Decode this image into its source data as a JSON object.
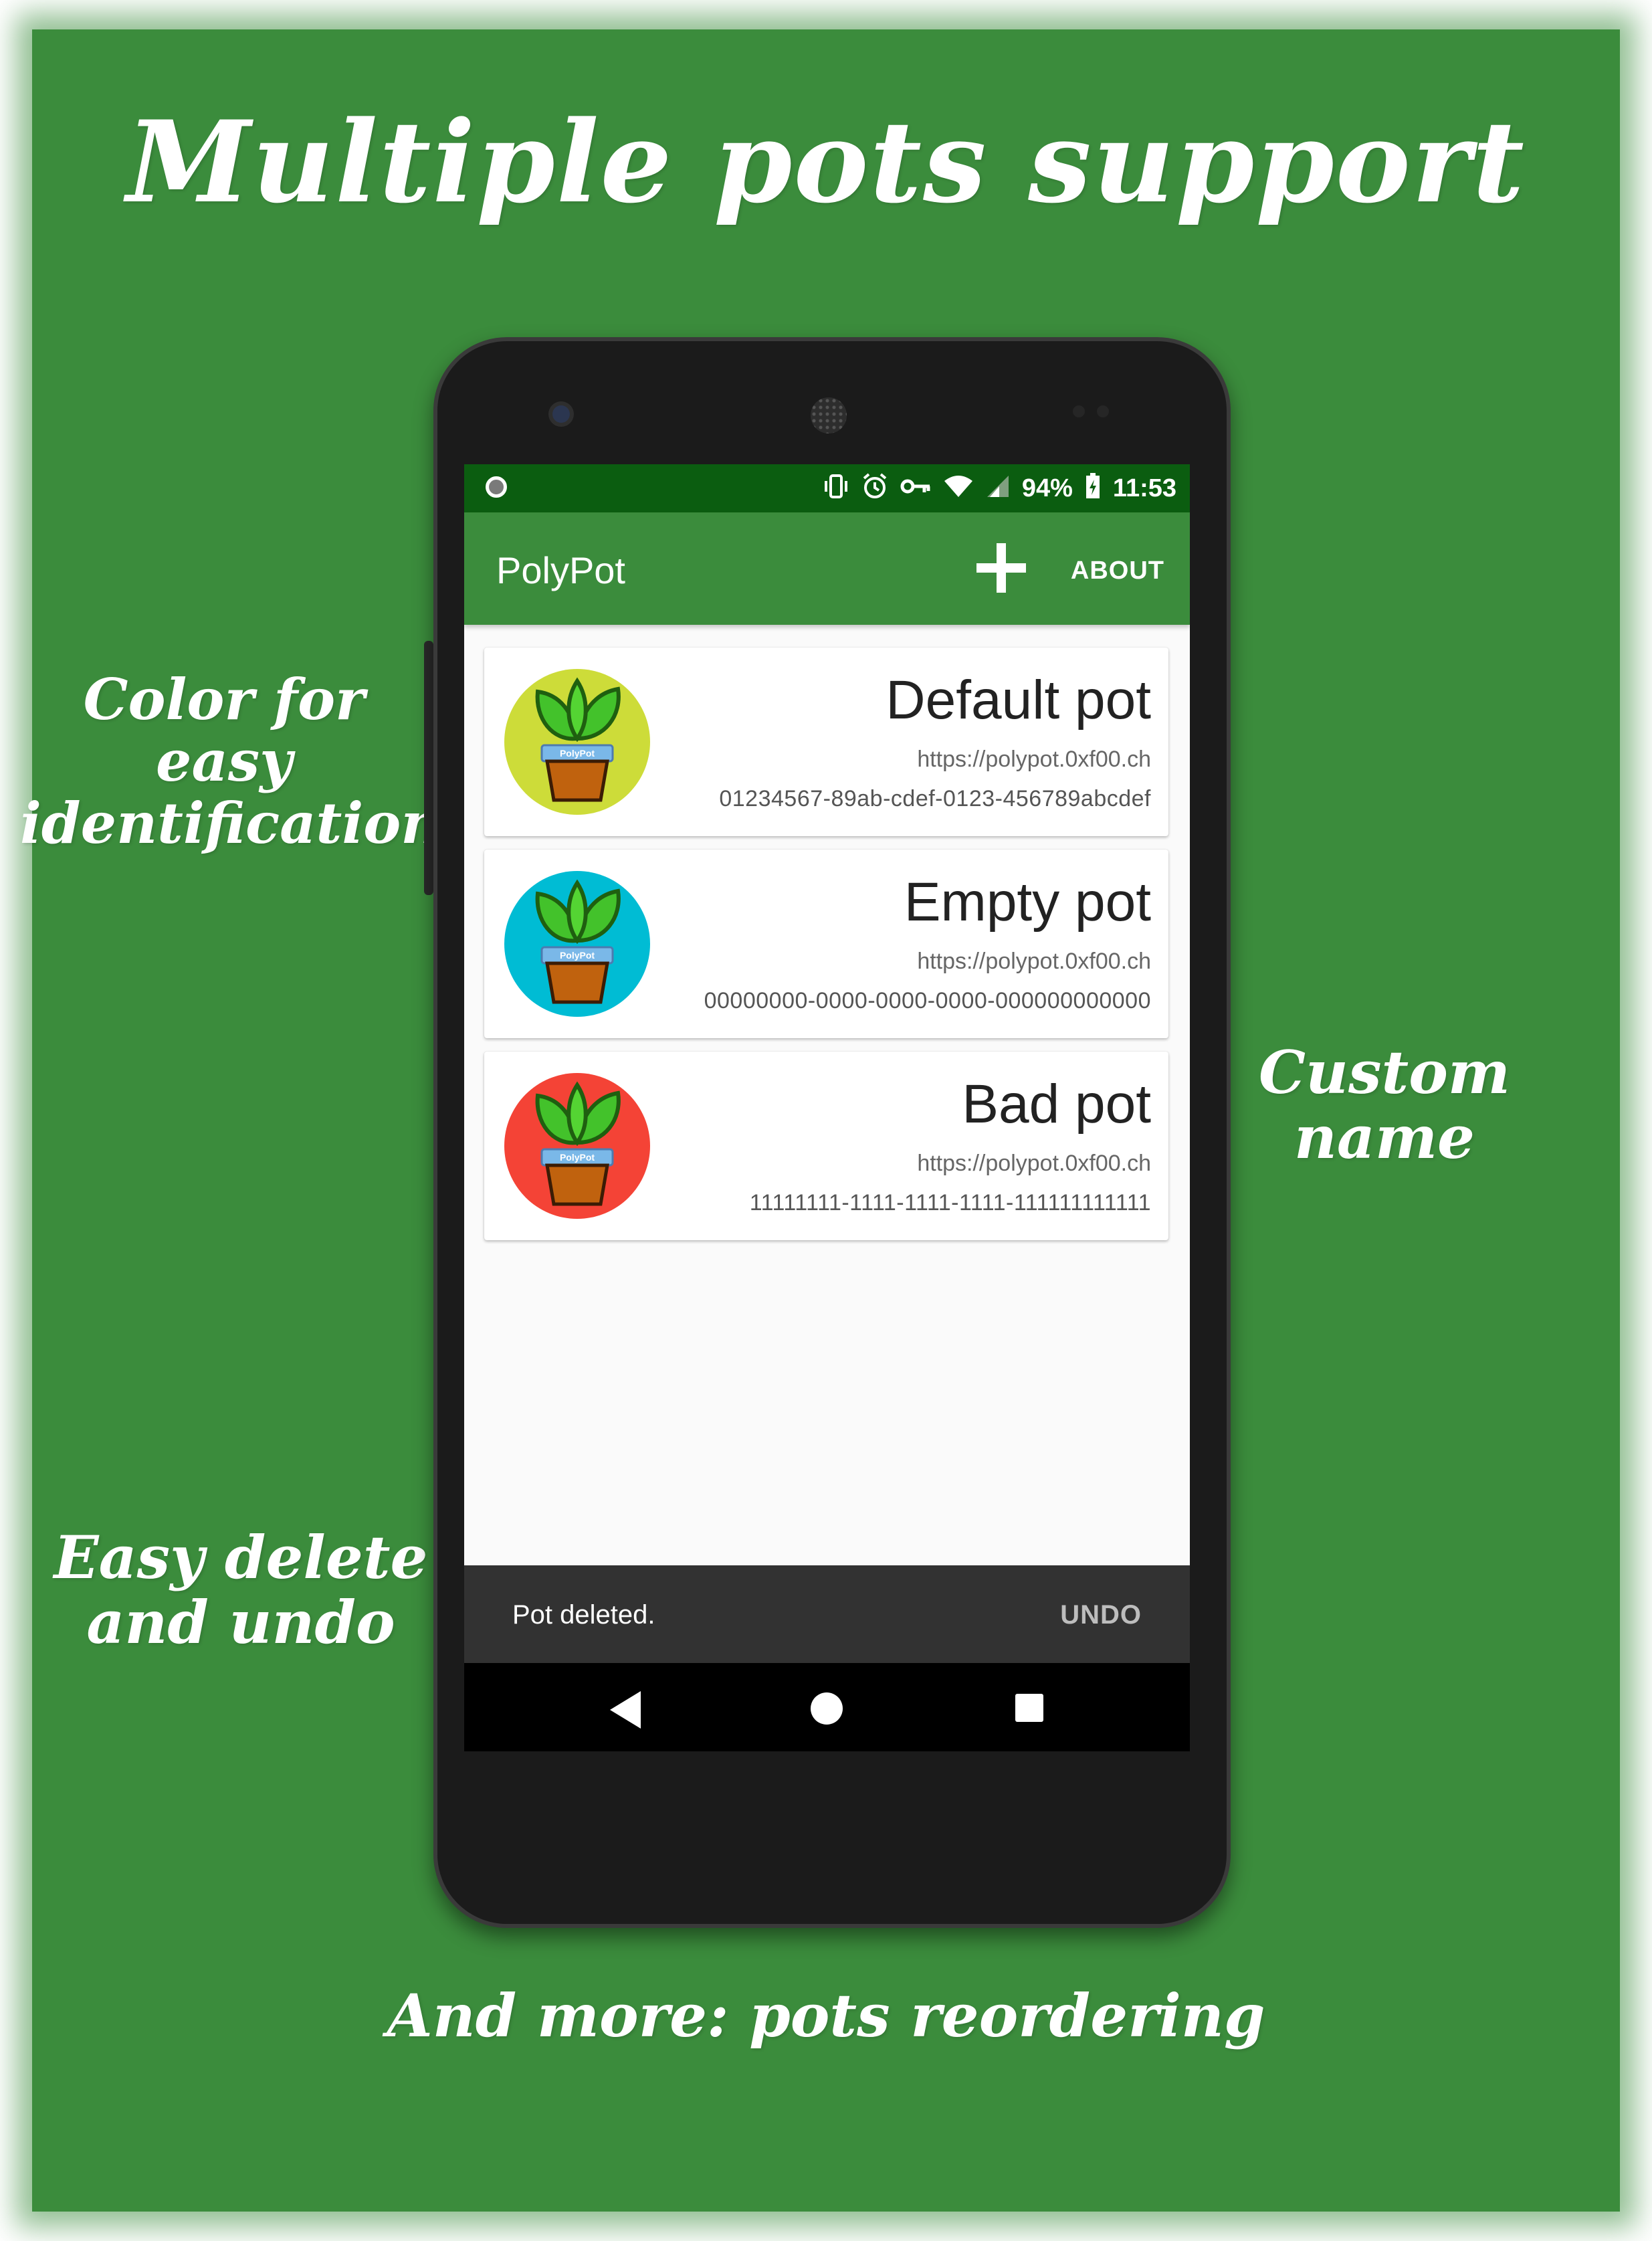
{
  "promo": {
    "headline": "Multiple pots support",
    "callout_color": "Color  for\neasy\nidentification",
    "callout_name": "Custom\nname",
    "callout_delete": "Easy delete\nand undo",
    "footer": "And more: pots reordering"
  },
  "status_bar": {
    "battery": "94%",
    "time": "11:53",
    "icons": [
      "vibrate-icon",
      "alarm-icon",
      "vpn-key-icon",
      "wifi-icon",
      "signal-icon",
      "battery-charging-icon"
    ]
  },
  "app_bar": {
    "title": "PolyPot",
    "add_icon": "plus-icon",
    "about_label": "ABOUT"
  },
  "pots": [
    {
      "name": "Default pot",
      "url": "https://polypot.0xf00.ch",
      "id": "01234567-89ab-cdef-0123-456789abcdef",
      "color": "#cddc39"
    },
    {
      "name": "Empty pot",
      "url": "https://polypot.0xf00.ch",
      "id": "00000000-0000-0000-0000-000000000000",
      "color": "#00bcd4"
    },
    {
      "name": "Bad pot",
      "url": "https://polypot.0xf00.ch",
      "id": "11111111-1111-1111-1111-111111111111",
      "color": "#f44336"
    }
  ],
  "pot_logo_label": "PolyPot",
  "snackbar": {
    "message": "Pot deleted.",
    "action": "UNDO"
  },
  "nav": {
    "back_icon": "back-triangle-icon",
    "home_icon": "home-circle-icon",
    "recents_icon": "recents-square-icon"
  },
  "colors": {
    "background_green": "#3b8c3c",
    "status_bar": "#0b5d10",
    "app_bar": "#3b8c3c"
  }
}
